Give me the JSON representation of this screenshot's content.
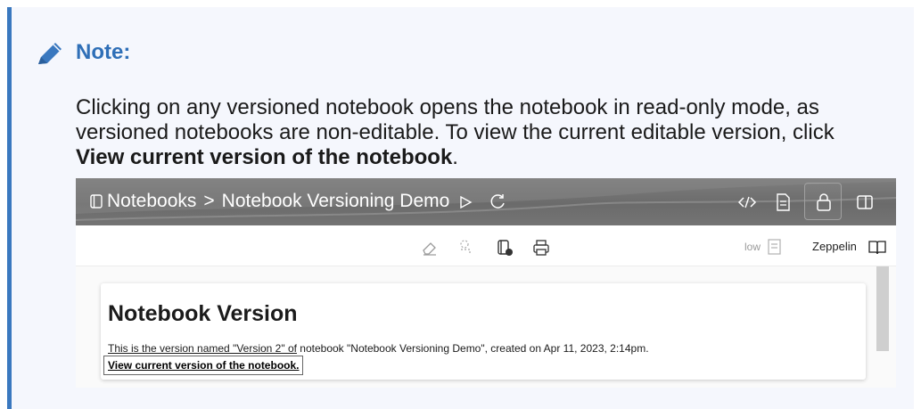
{
  "note": {
    "title": "Note:",
    "text_before": "Clicking on any versioned notebook opens the notebook in read-only mode, as versioned notebooks are non-editable. To view the current editable version, click ",
    "text_bold": "View current version of the notebook",
    "text_after": "."
  },
  "screenshot": {
    "breadcrumb": {
      "root": "Notebooks",
      "separator": ">",
      "current": "Notebook Versioning Demo"
    },
    "toolbar": {
      "low_label": "low",
      "interpreter_label": "Zeppelin"
    },
    "card": {
      "heading": "Notebook Version",
      "text_underlined": "This is the version named \"Version 2\" of",
      "text_rest": " notebook \"Notebook Versioning Demo\", created on Apr 11, 2023, 2:14pm.",
      "link": "View current version of the notebook."
    }
  },
  "colors": {
    "accent": "#3a78bf",
    "note_background": "#f5f7fd",
    "title": "#2f6fb7",
    "topbar": "#737373"
  },
  "icons": [
    "pencil-icon",
    "notebook-icon",
    "play-icon",
    "refresh-icon",
    "code-icon",
    "document-icon",
    "lock-icon",
    "panel-icon",
    "eraser-icon",
    "clear-output-icon",
    "notebook-settings-icon",
    "print-icon",
    "list-icon",
    "book-icon"
  ]
}
